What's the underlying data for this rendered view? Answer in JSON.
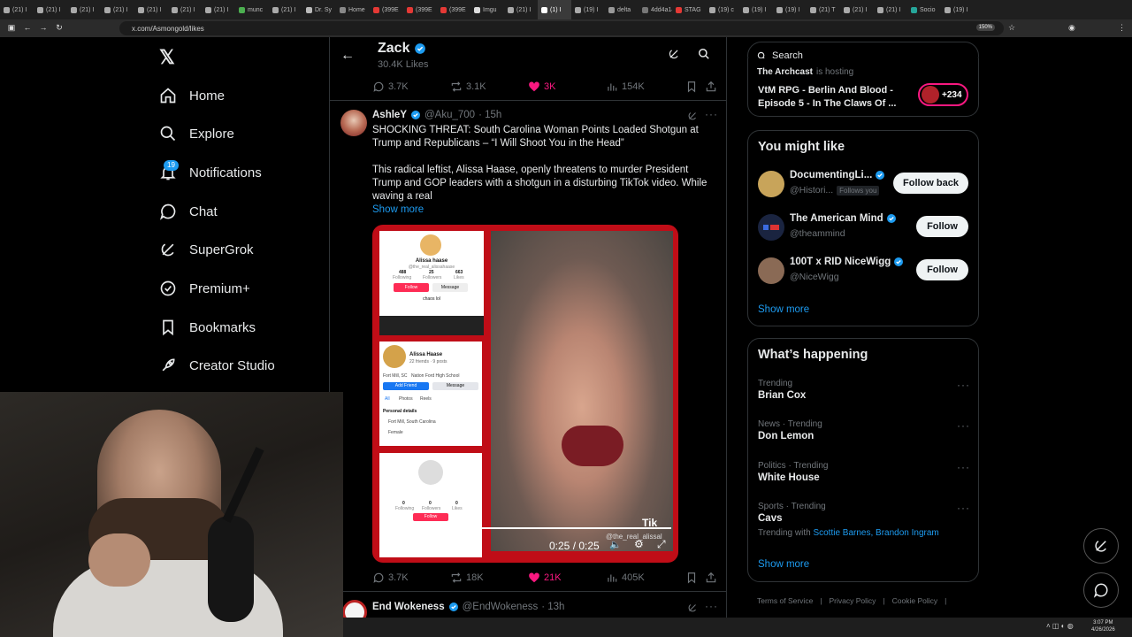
{
  "browser": {
    "tabs": [
      "(21) I",
      "(21) I",
      "(21) I",
      "(21) I",
      "(21) I",
      "(21) I",
      "(21) I",
      "munc",
      "(21) I",
      "Dr. Sy",
      "Home",
      "(399E",
      "(399E",
      "(399E",
      "Imgu",
      "(21) I",
      "(1) I",
      "(19) I",
      "delta",
      "4dd4a14",
      "STAG",
      "(19) c",
      "(19) I",
      "(19) I",
      "(21) T",
      "(21) I",
      "(21) I",
      "Socio",
      "(19) I"
    ],
    "tab_colors": [
      "#aaa",
      "#aaa",
      "#aaa",
      "#aaa",
      "#aaa",
      "#aaa",
      "#aaa",
      "#4caf50",
      "#aaa",
      "#bbb",
      "#888",
      "#e53935",
      "#e53935",
      "#e53935",
      "#ddd",
      "#aaa",
      "#fff",
      "#aaa",
      "#999",
      "#777",
      "#e53935",
      "#aaa",
      "#aaa",
      "#aaa",
      "#aaa",
      "#aaa",
      "#aaa",
      "#26a69a",
      "#aaa"
    ],
    "url": "x.com/Asmongold/likes",
    "zoom": "150%"
  },
  "nav": {
    "home": "Home",
    "explore": "Explore",
    "notifications": "Notifications",
    "notifications_badge": "19",
    "chat": "Chat",
    "supergrok": "SuperGrok",
    "premium": "Premium+",
    "bookmarks": "Bookmarks",
    "creator_studio": "Creator Studio"
  },
  "profile": {
    "name": "Zack",
    "subtitle": "30.4K Likes"
  },
  "prev_post_actions": {
    "replies": "3.7K",
    "reposts": "3.1K",
    "likes": "3K",
    "views": "154K"
  },
  "post": {
    "author": "AshleY",
    "handle": "@Aku_700",
    "time": "· 15h",
    "line1": "SHOCKING THREAT: South Carolina Woman Points Loaded Shotgun at Trump and Republicans – “I Will Shoot You in the Head”",
    "line2": "This radical leftist, Alissa Haase, openly threatens to murder President Trump and GOP leaders with a shotgun in a disturbing TikTok video. While waving a real",
    "show_more": "Show more",
    "video_time": "0:25 / 0:25",
    "video_watermark": "Tik",
    "video_handle": "@the_real_alissal",
    "tiktok_panel": {
      "name": "Alissa haase",
      "handle": "@the_real_alissahaase",
      "following": "488",
      "following_label": "Following",
      "followers": "25",
      "followers_label": "Followers",
      "likes": "663",
      "likes_label": "Likes",
      "follow": "Follow",
      "message": "Message",
      "bio": "chaos lol"
    },
    "fb_panel": {
      "name": "Alissa Haase",
      "sub": "22 friends · 9 posts",
      "loc1": "Fort Mill, SC",
      "loc2": "Nation Ford High School",
      "add": "Add Friend",
      "msg": "Message",
      "tabs": [
        "All",
        "Photos",
        "Reels"
      ],
      "details": "Personal details",
      "detail1": "Fort Mill, South Carolina",
      "detail2": "Female"
    },
    "empty_panel": {
      "following": "0",
      "followers": "0",
      "likes": "0",
      "following_label": "Following",
      "followers_label": "Followers",
      "likes_label": "Likes",
      "follow": "Follow"
    },
    "actions": {
      "replies": "3.7K",
      "reposts": "18K",
      "likes": "21K",
      "views": "405K"
    }
  },
  "next_post": {
    "author": "End Wokeness",
    "handle": "@EndWokeness",
    "time": "· 13h"
  },
  "search": {
    "placeholder": "Search"
  },
  "spaces": {
    "host": "The Archcast",
    "host_status": "is hosting",
    "title": "VtM RPG - Berlin And Blood - Episode 5 - In The Claws Of ...",
    "listeners": "+234"
  },
  "might_like": {
    "title": "You might like",
    "people": [
      {
        "name": "DocumentingLi...",
        "handle": "@Histori...",
        "tag": "Follows you",
        "button": "Follow back",
        "avatar": "#c8a45a"
      },
      {
        "name": "The American Mind",
        "handle": "@theammind",
        "tag": "",
        "button": "Follow",
        "avatar": "#1a2440"
      },
      {
        "name": "100T x RID NiceWigg",
        "handle": "@NiceWigg",
        "tag": "",
        "button": "Follow",
        "avatar": "#8a6a55"
      }
    ],
    "show_more": "Show more"
  },
  "happening": {
    "title": "What’s happening",
    "trends": [
      {
        "context": "Trending",
        "name": "Brian Cox",
        "extra": ""
      },
      {
        "context": "News · Trending",
        "name": "Don Lemon",
        "extra": ""
      },
      {
        "context": "Politics · Trending",
        "name": "White House",
        "extra": ""
      },
      {
        "context": "Sports · Trending",
        "name": "Cavs",
        "extra": "Trending with",
        "links": "Scottie Barnes, Brandon Ingram"
      }
    ],
    "show_more": "Show more"
  },
  "footer": {
    "terms": "Terms of Service",
    "privacy": "Privacy Policy",
    "cookie": "Cookie Policy"
  },
  "taskbar": {
    "time": "3:07 PM",
    "date": "4/26/2026"
  },
  "colors": {
    "accent": "#1d9bf0",
    "like": "#f91880",
    "video_border": "#d0101a"
  }
}
